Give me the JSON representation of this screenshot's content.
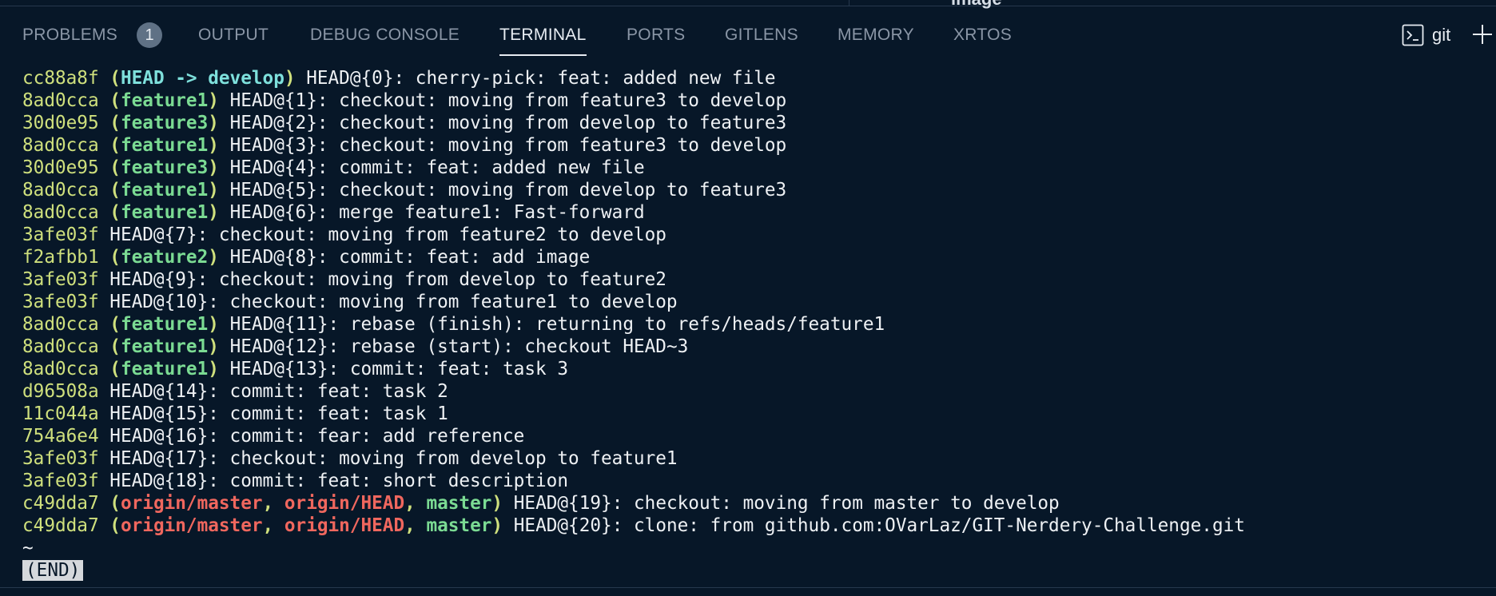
{
  "top_fragment": "image",
  "panel_tabs": [
    {
      "label": "PROBLEMS",
      "badge": "1"
    },
    {
      "label": "OUTPUT"
    },
    {
      "label": "DEBUG CONSOLE"
    },
    {
      "label": "TERMINAL",
      "active": true
    },
    {
      "label": "PORTS"
    },
    {
      "label": "GITLENS"
    },
    {
      "label": "MEMORY"
    },
    {
      "label": "XRTOS"
    }
  ],
  "terminal_session": {
    "label": "git",
    "icon": "terminal-icon"
  },
  "add_terminal_icon": "plus-icon",
  "colors": {
    "background": "#071728",
    "hash": "#cfe07d",
    "head_ref": "#7ee0dc",
    "branch_ref": "#7bdb93",
    "origin_ref": "#f0675e"
  },
  "reflog": [
    {
      "hash": "cc88a8f",
      "refs": [
        {
          "name": "HEAD -> develop",
          "type": "head"
        }
      ],
      "entry": "HEAD@{0}: cherry-pick: feat: added new file"
    },
    {
      "hash": "8ad0cca",
      "refs": [
        {
          "name": "feature1",
          "type": "branch"
        }
      ],
      "entry": "HEAD@{1}: checkout: moving from feature3 to develop"
    },
    {
      "hash": "30d0e95",
      "refs": [
        {
          "name": "feature3",
          "type": "branch"
        }
      ],
      "entry": "HEAD@{2}: checkout: moving from develop to feature3"
    },
    {
      "hash": "8ad0cca",
      "refs": [
        {
          "name": "feature1",
          "type": "branch"
        }
      ],
      "entry": "HEAD@{3}: checkout: moving from feature3 to develop"
    },
    {
      "hash": "30d0e95",
      "refs": [
        {
          "name": "feature3",
          "type": "branch"
        }
      ],
      "entry": "HEAD@{4}: commit: feat: added new file"
    },
    {
      "hash": "8ad0cca",
      "refs": [
        {
          "name": "feature1",
          "type": "branch"
        }
      ],
      "entry": "HEAD@{5}: checkout: moving from develop to feature3"
    },
    {
      "hash": "8ad0cca",
      "refs": [
        {
          "name": "feature1",
          "type": "branch"
        }
      ],
      "entry": "HEAD@{6}: merge feature1: Fast-forward"
    },
    {
      "hash": "3afe03f",
      "refs": [],
      "entry": "HEAD@{7}: checkout: moving from feature2 to develop"
    },
    {
      "hash": "f2afbb1",
      "refs": [
        {
          "name": "feature2",
          "type": "branch"
        }
      ],
      "entry": "HEAD@{8}: commit: feat: add image"
    },
    {
      "hash": "3afe03f",
      "refs": [],
      "entry": "HEAD@{9}: checkout: moving from develop to feature2"
    },
    {
      "hash": "3afe03f",
      "refs": [],
      "entry": "HEAD@{10}: checkout: moving from feature1 to develop"
    },
    {
      "hash": "8ad0cca",
      "refs": [
        {
          "name": "feature1",
          "type": "branch"
        }
      ],
      "entry": "HEAD@{11}: rebase (finish): returning to refs/heads/feature1"
    },
    {
      "hash": "8ad0cca",
      "refs": [
        {
          "name": "feature1",
          "type": "branch"
        }
      ],
      "entry": "HEAD@{12}: rebase (start): checkout HEAD~3"
    },
    {
      "hash": "8ad0cca",
      "refs": [
        {
          "name": "feature1",
          "type": "branch"
        }
      ],
      "entry": "HEAD@{13}: commit: feat: task 3"
    },
    {
      "hash": "d96508a",
      "refs": [],
      "entry": "HEAD@{14}: commit: feat: task 2"
    },
    {
      "hash": "11c044a",
      "refs": [],
      "entry": "HEAD@{15}: commit: feat: task 1"
    },
    {
      "hash": "754a6e4",
      "refs": [],
      "entry": "HEAD@{16}: commit: fear: add reference"
    },
    {
      "hash": "3afe03f",
      "refs": [],
      "entry": "HEAD@{17}: checkout: moving from develop to feature1"
    },
    {
      "hash": "3afe03f",
      "refs": [],
      "entry": "HEAD@{18}: commit: feat: short description"
    },
    {
      "hash": "c49dda7",
      "refs": [
        {
          "name": "origin/master",
          "type": "origin"
        },
        {
          "name": "origin/HEAD",
          "type": "origin"
        },
        {
          "name": "master",
          "type": "master"
        }
      ],
      "entry": "HEAD@{19}: checkout: moving from master to develop"
    },
    {
      "hash": "c49dda7",
      "refs": [
        {
          "name": "origin/master",
          "type": "origin"
        },
        {
          "name": "origin/HEAD",
          "type": "origin"
        },
        {
          "name": "master",
          "type": "master"
        }
      ],
      "entry": "HEAD@{20}: clone: from github.com:OVarLaz/GIT-Nerdery-Challenge.git"
    }
  ],
  "pager": {
    "tilde": "~",
    "end": "(END)"
  }
}
